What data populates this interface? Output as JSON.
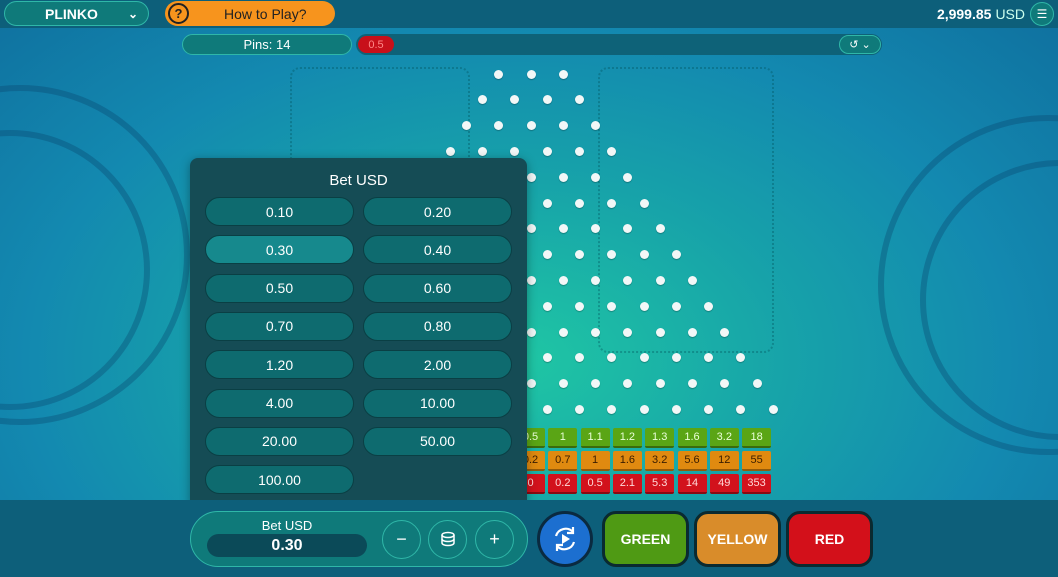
{
  "header": {
    "game_name": "PLINKO",
    "how_to_play": "How to Play?",
    "balance_amount": "2,999.85",
    "balance_currency": "USD",
    "help_icon": "question-circle-icon",
    "menu_icon": "hamburger-icon"
  },
  "pins_bar": {
    "pins_label": "Pins: 14",
    "history": [
      "0.5"
    ]
  },
  "multipliers": {
    "green": [
      "0.5",
      "1",
      "1.1",
      "1.2",
      "1.3",
      "1.6",
      "3.2",
      "18"
    ],
    "yellow": [
      "0.2",
      "0.7",
      "1",
      "1.6",
      "3.2",
      "5.6",
      "12",
      "55"
    ],
    "red": [
      "0",
      "0.2",
      "0.5",
      "2.1",
      "5.3",
      "14",
      "49",
      "353"
    ]
  },
  "bet_popup": {
    "title": "Bet USD",
    "options": [
      "0.10",
      "0.20",
      "0.30",
      "0.40",
      "0.50",
      "0.60",
      "0.70",
      "0.80",
      "1.20",
      "2.00",
      "4.00",
      "10.00",
      "20.00",
      "50.00",
      "100.00"
    ],
    "selected": "0.30"
  },
  "bet_control": {
    "label": "Bet USD",
    "value": "0.30",
    "minus": "−",
    "plus": "+"
  },
  "actions": {
    "green": "GREEN",
    "yellow": "YELLOW",
    "red": "RED"
  },
  "colors": {
    "green": "#4f9a14",
    "yellow": "#d98c2a",
    "red": "#d3101a",
    "orange_button": "#f7941d"
  }
}
